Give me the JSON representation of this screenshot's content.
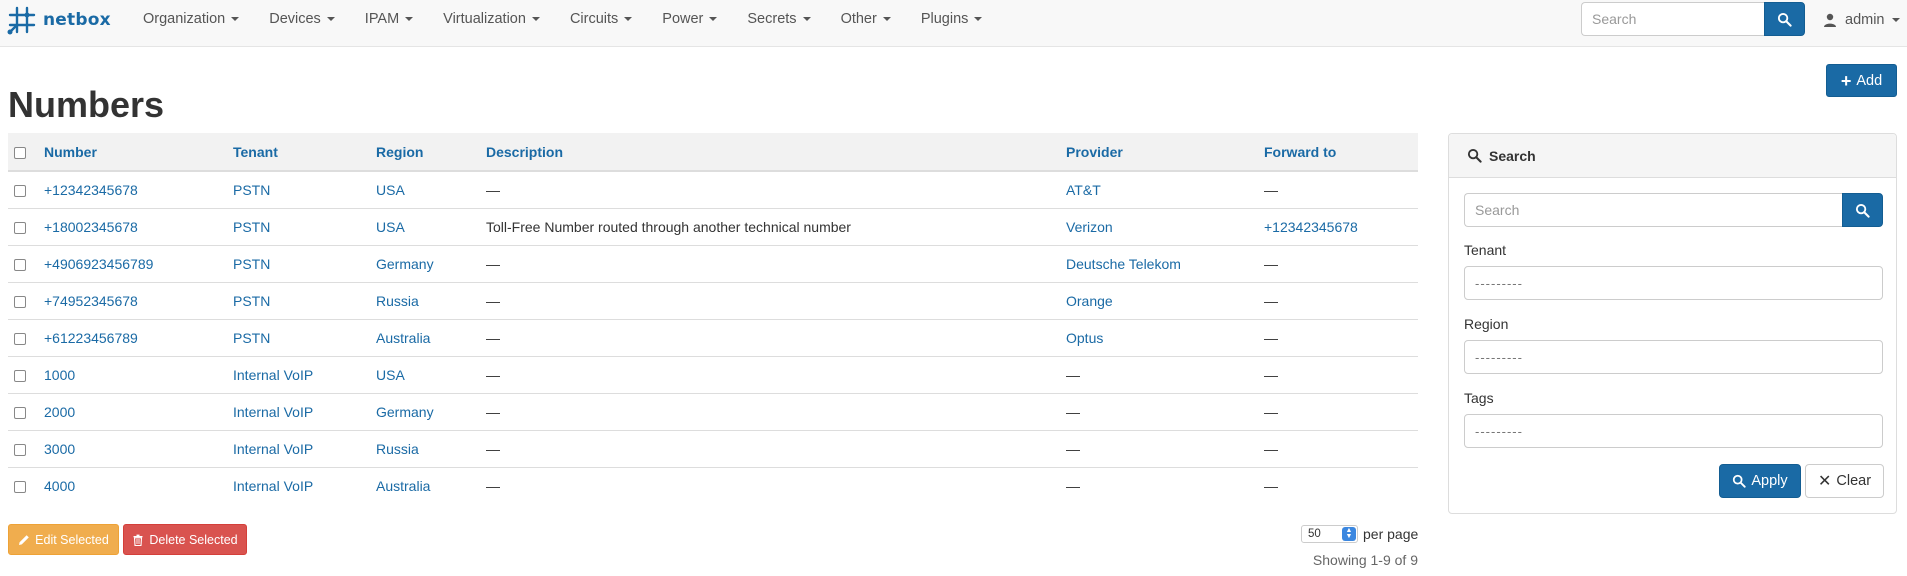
{
  "brand": {
    "name": "netbox"
  },
  "nav": {
    "menus": [
      "Organization",
      "Devices",
      "IPAM",
      "Virtualization",
      "Circuits",
      "Power",
      "Secrets",
      "Other",
      "Plugins"
    ],
    "search_placeholder": "Search",
    "user": "admin"
  },
  "page": {
    "title": "Numbers",
    "add_label": "Add"
  },
  "table": {
    "headers": [
      "Number",
      "Tenant",
      "Region",
      "Description",
      "Provider",
      "Forward to"
    ],
    "rows": [
      [
        "+12342345678",
        "PSTN",
        "USA",
        "—",
        "AT&T",
        "—"
      ],
      [
        "+18002345678",
        "PSTN",
        "USA",
        "Toll-Free Number routed through another technical number",
        "Verizon",
        "+12342345678"
      ],
      [
        "+4906923456789",
        "PSTN",
        "Germany",
        "—",
        "Deutsche Telekom",
        "—"
      ],
      [
        "+74952345678",
        "PSTN",
        "Russia",
        "—",
        "Orange",
        "—"
      ],
      [
        "+61223456789",
        "PSTN",
        "Australia",
        "—",
        "Optus",
        "—"
      ],
      [
        "1000",
        "Internal VoIP",
        "USA",
        "—",
        "—",
        "—"
      ],
      [
        "2000",
        "Internal VoIP",
        "Germany",
        "—",
        "—",
        "—"
      ],
      [
        "3000",
        "Internal VoIP",
        "Russia",
        "—",
        "—",
        "—"
      ],
      [
        "4000",
        "Internal VoIP",
        "Australia",
        "—",
        "—",
        "—"
      ]
    ]
  },
  "actions": {
    "edit_selected": "Edit Selected",
    "delete_selected": "Delete Selected"
  },
  "pagination": {
    "per_page_value": "50",
    "per_page_label": "per page",
    "showing": "Showing 1-9 of 9"
  },
  "filter_panel": {
    "title": "Search",
    "search_placeholder": "Search",
    "tenant_label": "Tenant",
    "tenant_value": "---------",
    "region_label": "Region",
    "region_value": "---------",
    "tags_label": "Tags",
    "tags_value": "---------",
    "apply_label": "Apply",
    "clear_label": "Clear"
  },
  "colors": {
    "primary": "#1a6aa5",
    "warning": "#f0ad4e",
    "danger": "#d9534f"
  }
}
